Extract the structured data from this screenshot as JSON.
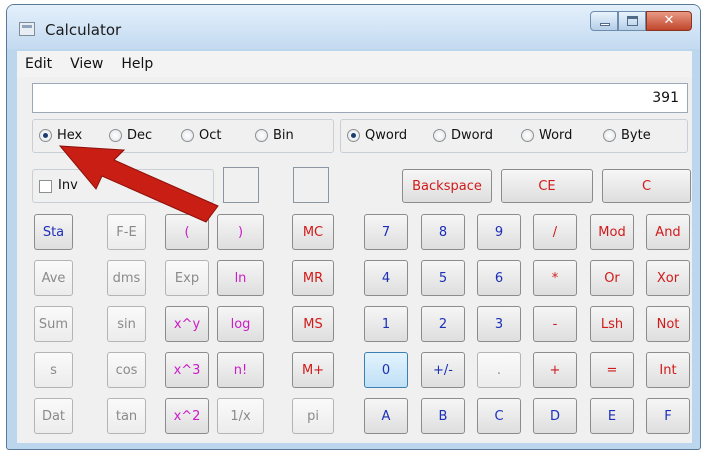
{
  "window": {
    "title": "Calculator"
  },
  "menu": [
    "Edit",
    "View",
    "Help"
  ],
  "display": {
    "value": "391"
  },
  "radix": {
    "options": [
      "Hex",
      "Dec",
      "Oct",
      "Bin"
    ],
    "selected": "Hex"
  },
  "wordsize": {
    "options": [
      "Qword",
      "Dword",
      "Word",
      "Byte"
    ],
    "selected": "Qword"
  },
  "inv_label": "Inv",
  "edit_buttons": [
    "Backspace",
    "CE",
    "C"
  ],
  "colors": {
    "blue": "#1c2fb8",
    "red": "#d11a1a",
    "magenta": "#cc1cc8",
    "gray": "#8a8a8a",
    "arrow": "#c81e14"
  },
  "keys": {
    "stat": [
      "Sta",
      "Ave",
      "Sum",
      "s",
      "Dat"
    ],
    "sci_1": [
      "F-E",
      "dms",
      "sin",
      "cos",
      "tan"
    ],
    "sci_2": [
      "(",
      "Exp",
      "x^y",
      "x^3",
      "x^2"
    ],
    "sci_3": [
      ")",
      "ln",
      "log",
      "n!",
      "1/x"
    ],
    "memory": [
      "MC",
      "MR",
      "MS",
      "M+",
      "pi"
    ],
    "digits_1": [
      "7",
      "4",
      "1",
      "0",
      "A"
    ],
    "digits_2": [
      "8",
      "5",
      "2",
      "+/-",
      "B"
    ],
    "digits_3": [
      "9",
      "6",
      "3",
      ".",
      "C"
    ],
    "ops_1": [
      "/",
      "*",
      "-",
      "+",
      "D"
    ],
    "ops_2": [
      "Mod",
      "Or",
      "Lsh",
      "=",
      "E"
    ],
    "ops_3": [
      "And",
      "Xor",
      "Not",
      "Int",
      "F"
    ]
  }
}
